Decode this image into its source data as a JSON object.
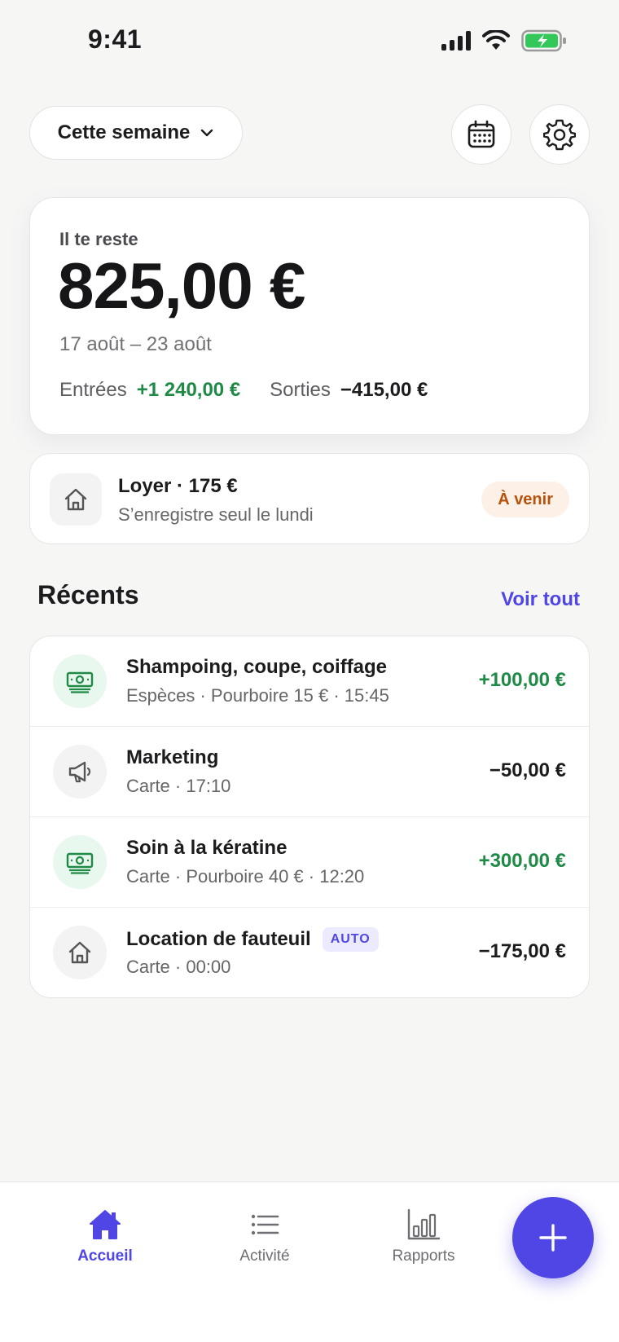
{
  "status_bar": {
    "time": "9:41"
  },
  "header": {
    "period_label": "Cette semaine"
  },
  "summary": {
    "label": "Il te reste",
    "amount": "825,00 €",
    "date_range": "17 août – 23 août",
    "income_label": "Entrées",
    "income_value": "+1 240,00 €",
    "expense_label": "Sorties",
    "expense_value": "−415,00 €"
  },
  "recurring": {
    "title": "Loyer · 175 €",
    "subtitle": "S’enregistre seul le lundi",
    "badge": "À venir"
  },
  "recent": {
    "title": "Récents",
    "see_all": "Voir tout",
    "items": [
      {
        "title": "Shampoing, coupe, coiffage",
        "meta": "Espèces · Pourboire 15 € · 15:45",
        "amount": "+100,00 €",
        "icon": "cash-icon"
      },
      {
        "title": "Marketing",
        "meta": "Carte · 17:10",
        "amount": "−50,00 €",
        "icon": "megaphone-icon"
      },
      {
        "title": "Soin à la kératine",
        "meta": "Carte · Pourboire 40 € · 12:20",
        "amount": "+300,00 €",
        "icon": "cash-icon"
      },
      {
        "title": "Location de fauteuil",
        "badge": "AUTO",
        "meta": "Carte · 00:00",
        "amount": "−175,00 €",
        "icon": "home-icon"
      }
    ]
  },
  "tabs": [
    {
      "label": "Accueil",
      "icon": "home-icon",
      "active": true
    },
    {
      "label": "Activité",
      "icon": "list-icon"
    },
    {
      "label": "Rapports",
      "icon": "bar-chart-icon"
    }
  ],
  "colors": {
    "accent": "#4f46e5",
    "positive": "#1e8a46",
    "warning": "#b5530e"
  }
}
